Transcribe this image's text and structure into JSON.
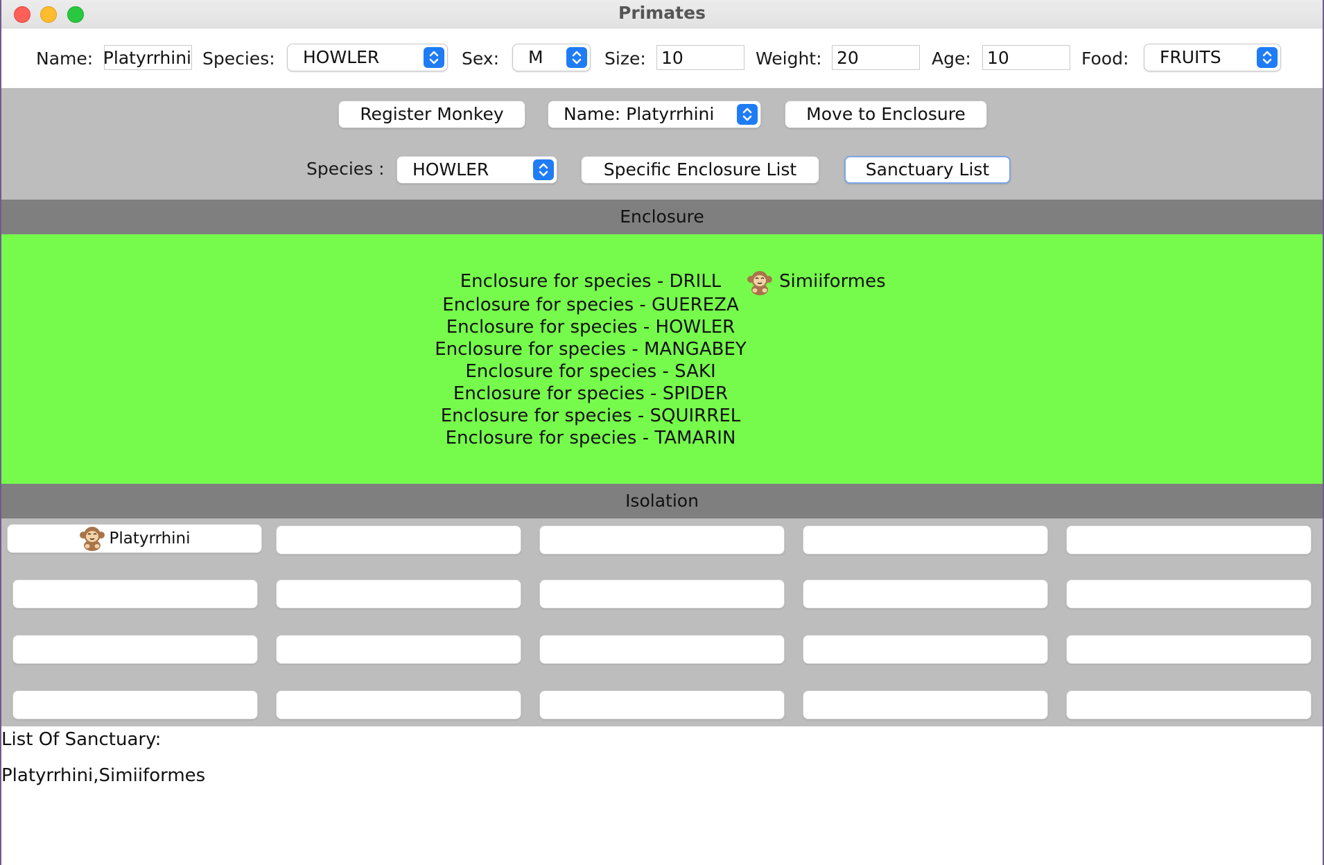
{
  "window": {
    "title": "Primates"
  },
  "form": {
    "name_label": "Name:",
    "name_value": "Platyrrhini",
    "species_label": "Species:",
    "species_value": "HOWLER",
    "sex_label": "Sex:",
    "sex_value": "M",
    "size_label": "Size:",
    "size_value": "10",
    "weight_label": "Weight:",
    "weight_value": "20",
    "age_label": "Age:",
    "age_value": "10",
    "food_label": "Food:",
    "food_value": "FRUITS"
  },
  "actions": {
    "register_label": "Register Monkey",
    "name_select_value": "Name: Platyrrhini",
    "move_label": "Move to Enclosure",
    "species_label": "Species :",
    "species_select_value": "HOWLER",
    "specific_list_label": "Specific Enclosure List",
    "sanctuary_list_label": "Sanctuary List"
  },
  "enclosure": {
    "header": "Enclosure",
    "lines": [
      "Enclosure for species - DRILL",
      "Enclosure for species - GUEREZA",
      "Enclosure for species - HOWLER",
      "Enclosure for species - MANGABEY",
      "Enclosure for species - SAKI",
      "Enclosure for species - SPIDER",
      "Enclosure for species - SQUIRREL",
      "Enclosure for species - TAMARIN"
    ],
    "monkey_name": "Simiiformes",
    "monkey_icon": "monkey-icon"
  },
  "isolation": {
    "header": "Isolation",
    "occupant": "Platyrrhini",
    "occupant_icon": "monkey-icon"
  },
  "output": {
    "title": "List Of Sanctuary:",
    "text": "Platyrrhini,Simiiformes"
  },
  "colors": {
    "enclosure_bg": "#76fb4c",
    "section_header_bg": "#7f7f7f",
    "panel_bg": "#bdbdbd",
    "accent": "#1f7cf5"
  }
}
